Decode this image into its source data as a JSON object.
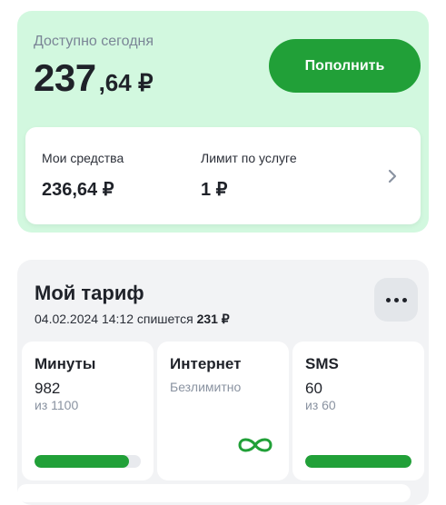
{
  "balance": {
    "label": "Доступно сегодня",
    "amount_int": "237",
    "amount_dec": ",64 ₽",
    "topup_label": "Пополнить",
    "funds": [
      {
        "label": "Мои средства",
        "value": "236,64 ₽"
      },
      {
        "label": "Лимит по услуге",
        "value": "1 ₽"
      }
    ]
  },
  "tariff": {
    "title": "Мой тариф",
    "charge_prefix": "04.02.2024 14:12 спишется",
    "charge_amount": "231 ₽",
    "tiles": [
      {
        "title": "Минуты",
        "value": "982",
        "sub": "из 1100",
        "progress": 0.89
      },
      {
        "title": "Интернет",
        "note": "Безлимитно",
        "icon": "infinity-icon"
      },
      {
        "title": "SMS",
        "value": "60",
        "sub": "из 60",
        "progress": 1.0
      }
    ]
  },
  "colors": {
    "accent": "#21a038",
    "balance_bg": "#d2f8df",
    "card_bg": "#f2f3f5"
  }
}
